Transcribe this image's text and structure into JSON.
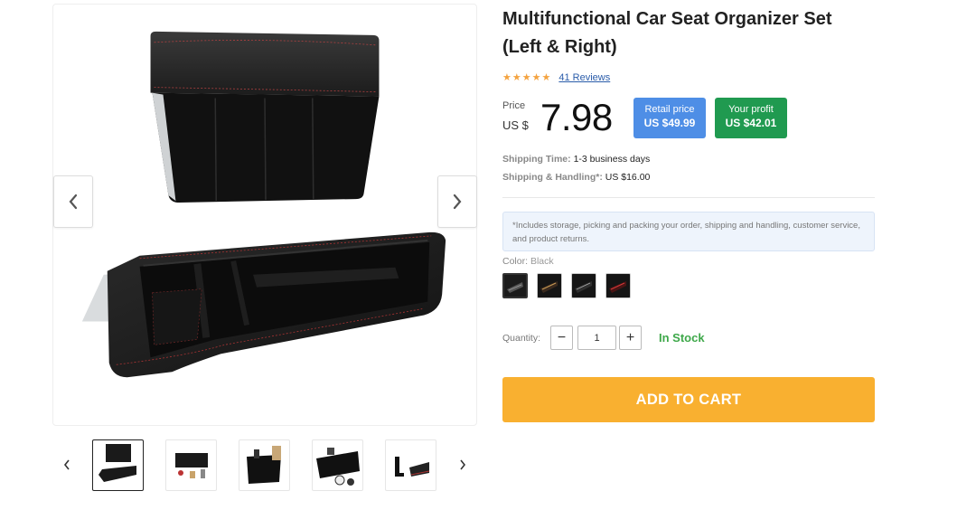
{
  "product": {
    "title": "Multifunctional Car Seat Organizer Set (Left & Right)",
    "reviews_link": "41 Reviews",
    "rating_stars": 5,
    "price_label": "Price",
    "currency": "US $",
    "price": "7.98",
    "retail_badge": {
      "label": "Retail price",
      "value": "US $49.99"
    },
    "profit_badge": {
      "label": "Your profit",
      "value": "US $42.01"
    },
    "shipping_time": {
      "label": "Shipping Time:",
      "value": "1-3 business days"
    },
    "shipping_handling": {
      "label": "Shipping & Handling*:",
      "value": "US $16.00"
    },
    "note": "*Includes storage, picking and packing your order, shipping and handling, customer service, and product returns.",
    "color": {
      "label": "Color:",
      "value": "Black",
      "swatch_count": 4,
      "selected_index": 0
    },
    "quantity": {
      "label": "Quantity:",
      "value": "1",
      "minus": "−",
      "plus": "+"
    },
    "stock_status": "In Stock",
    "add_to_cart": "ADD TO CART"
  },
  "gallery": {
    "thumbnail_count": 5,
    "active_thumbnail": 0
  },
  "colors": {
    "star": "#f4a340",
    "retail_badge": "#4e8ee6",
    "profit_badge": "#209a50",
    "in_stock": "#3ea84a",
    "cart_button": "#f9b030",
    "link": "#2a5caa"
  },
  "icons": {
    "gallery_prev": "chevron-left-icon",
    "gallery_next": "chevron-right-icon",
    "thumbs_prev": "chevron-left-icon",
    "thumbs_next": "chevron-right-icon",
    "star": "star-icon"
  }
}
